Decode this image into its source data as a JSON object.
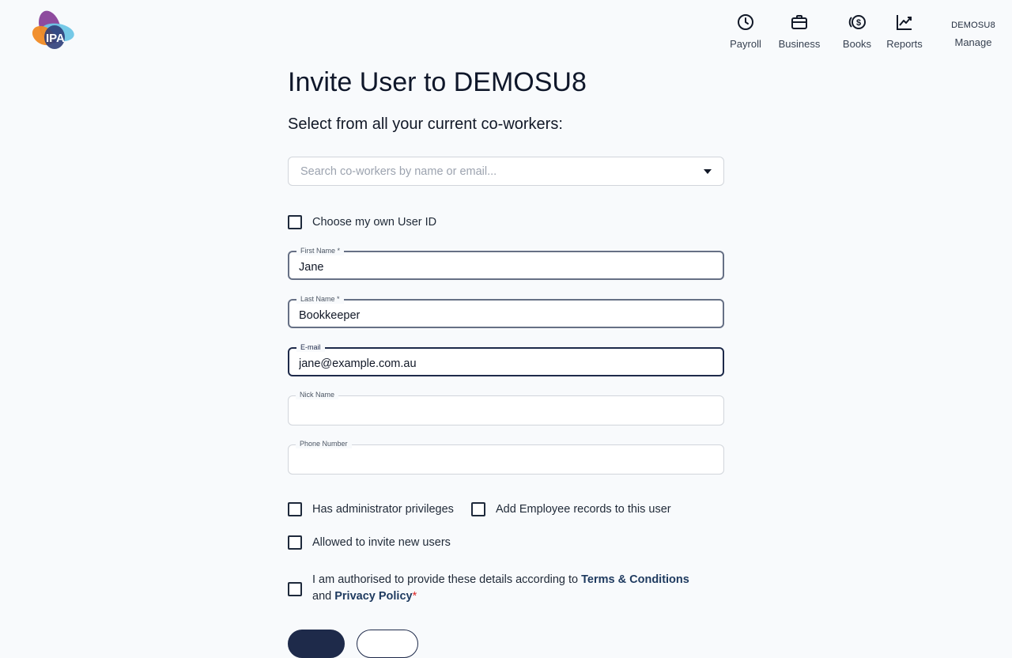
{
  "header": {
    "logo_text": "IPA",
    "nav": [
      {
        "label": "Payroll",
        "icon": "clock-icon"
      },
      {
        "label": "Business",
        "icon": "briefcase-icon"
      },
      {
        "label": "Books",
        "icon": "dollar-coins-icon"
      },
      {
        "label": "Reports",
        "icon": "trend-chart-icon"
      }
    ],
    "company_code": "DEMOSU8",
    "manage_label": "Manage"
  },
  "page": {
    "title": "Invite User to DEMOSU8",
    "subtitle": "Select from all your current co-workers:"
  },
  "search": {
    "placeholder": "Search co-workers by name or email...",
    "value": ""
  },
  "options": {
    "own_user_id": {
      "label": "Choose my own User ID",
      "checked": false
    },
    "admin": {
      "label": "Has administrator privileges",
      "checked": false
    },
    "employee_records": {
      "label": "Add Employee records to this user",
      "checked": false
    },
    "invite_users": {
      "label": "Allowed to invite new users",
      "checked": false
    }
  },
  "fields": {
    "first_name": {
      "label": "First Name *",
      "value": "Jane"
    },
    "last_name": {
      "label": "Last Name *",
      "value": "Bookkeeper"
    },
    "email": {
      "label": "E-mail",
      "value": "jane@example.com.au"
    },
    "nick_name": {
      "label": "Nick Name",
      "value": ""
    },
    "phone": {
      "label": "Phone Number",
      "value": ""
    }
  },
  "terms": {
    "prefix": "I am authorised to provide these details according to ",
    "terms_link": "Terms & Conditions",
    "middle": "and ",
    "privacy_link": "Privacy Policy",
    "required_mark": "*",
    "checked": false
  },
  "colors": {
    "background": "#f8fafc",
    "primary": "#1e2a4a",
    "link": "#1e3a5f",
    "required": "#dc2626"
  }
}
